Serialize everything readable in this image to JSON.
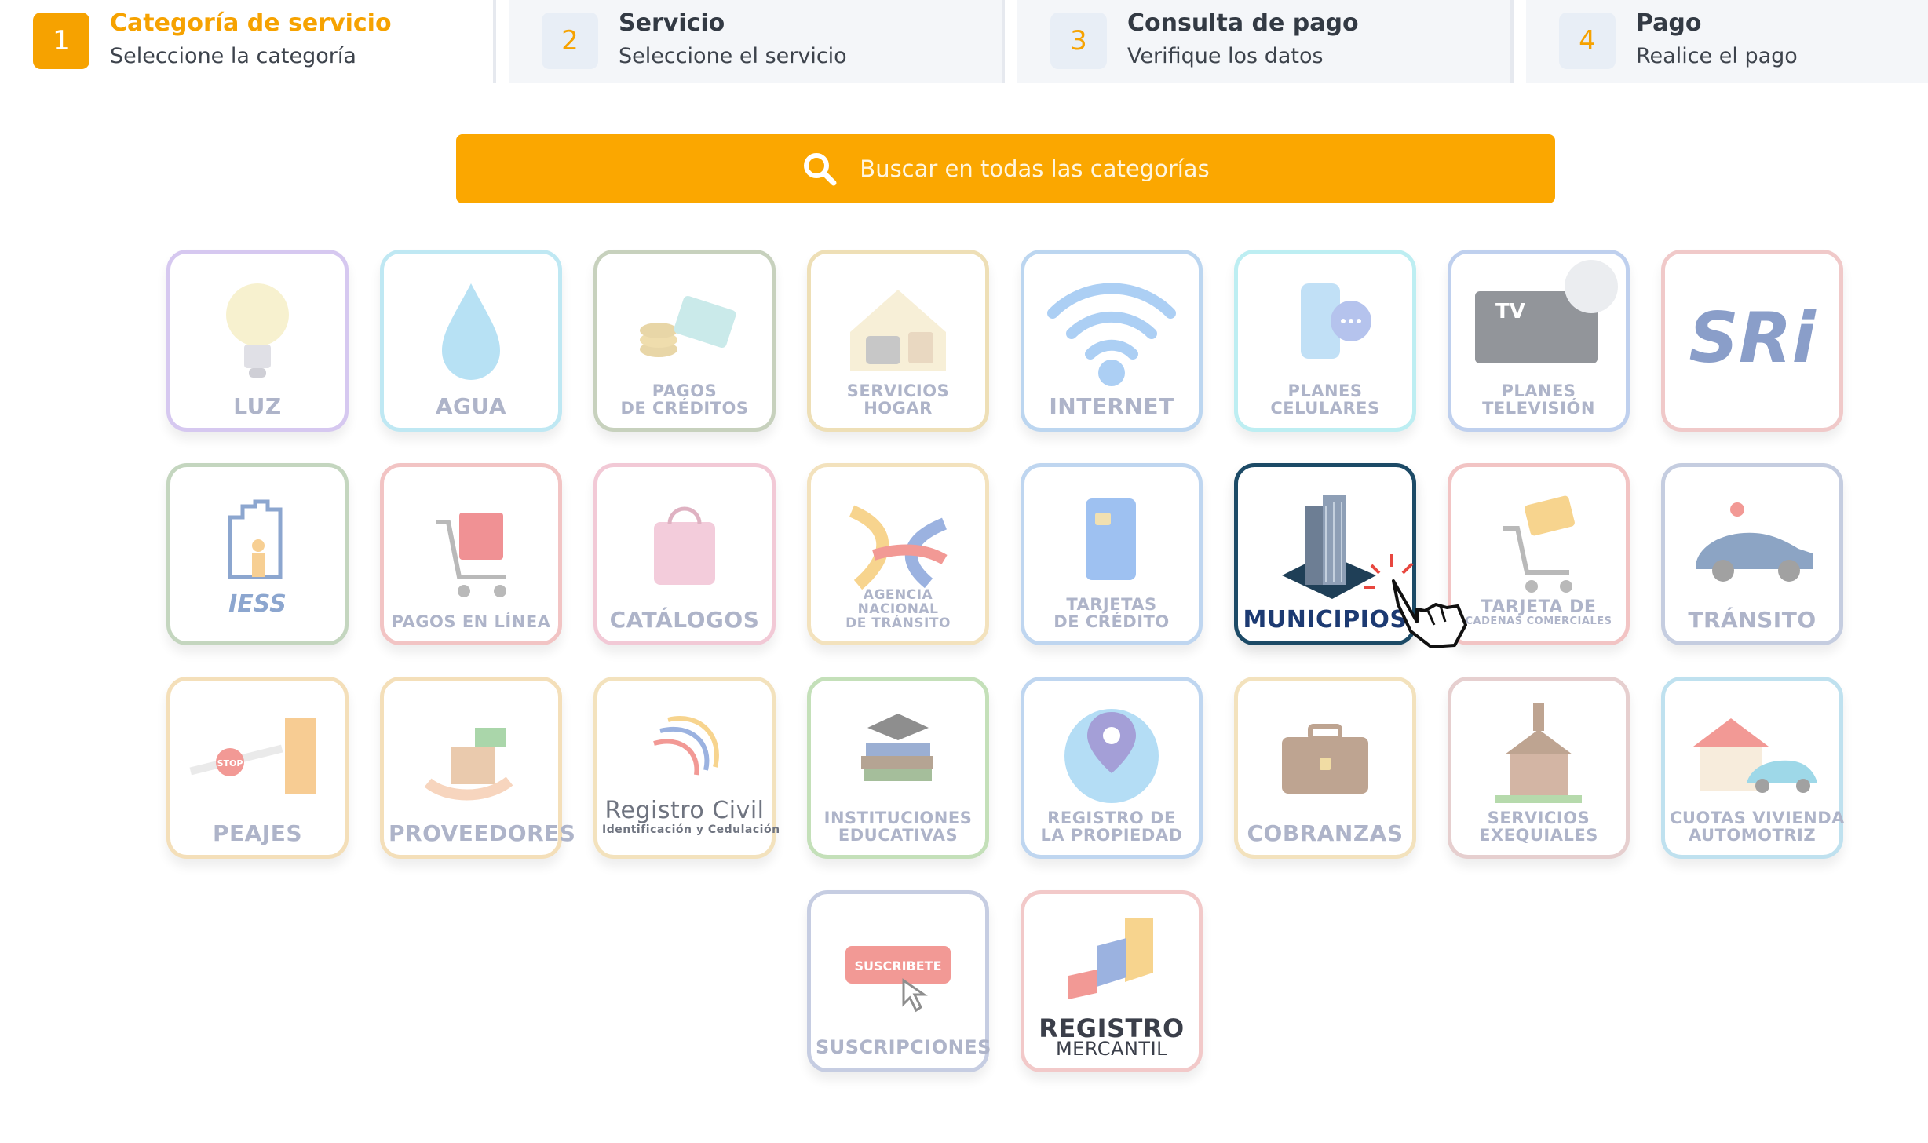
{
  "steps": [
    {
      "num": "1",
      "title": "Categoría de servicio",
      "subtitle": "Seleccione la categoría"
    },
    {
      "num": "2",
      "title": "Servicio",
      "subtitle": "Seleccione el servicio"
    },
    {
      "num": "3",
      "title": "Consulta de pago",
      "subtitle": "Verifique los datos"
    },
    {
      "num": "4",
      "title": "Pago",
      "subtitle": "Realice el pago"
    }
  ],
  "search": {
    "label": "Buscar en todas las categorías"
  },
  "categories": {
    "luz": "LUZ",
    "agua": "AGUA",
    "pagos_creditos": [
      "PAGOS",
      "DE CRÉDITOS"
    ],
    "servicios_hogar": [
      "SERVICIOS",
      "HOGAR"
    ],
    "internet": "INTERNET",
    "planes_celulares": [
      "PLANES",
      "CELULARES"
    ],
    "planes_television": [
      "PLANES",
      "TELEVISIÓN"
    ],
    "planes_television_tv": "TV",
    "sri": "SRi",
    "iess": "IESS",
    "pagos_linea": "PAGOS EN LÍNEA",
    "catalogos": "CATÁLOGOS",
    "ant": [
      "AGENCIA",
      "NACIONAL",
      "DE TRÁNSITO"
    ],
    "tarjetas_credito": [
      "TARJETAS",
      "DE CRÉDITO"
    ],
    "municipios": "MUNICIPIOS",
    "tarjeta_cadenas": [
      "TARJETA DE",
      "CADENAS COMERCIALES"
    ],
    "transito": "TRÁNSITO",
    "peajes": "PEAJES",
    "peajes_stop": "STOP",
    "proveedores": "PROVEEDORES",
    "registro_civil": [
      "Registro Civil",
      "Identificación y Cedulación"
    ],
    "instituciones": [
      "INSTITUCIONES",
      "EDUCATIVAS"
    ],
    "registro_propiedad": [
      "REGISTRO DE",
      "LA PROPIEDAD"
    ],
    "cobranzas": "COBRANZAS",
    "exequiales": [
      "SERVICIOS",
      "EXEQUIALES"
    ],
    "vivienda": [
      "CUOTAS VIVIENDA",
      "AUTOMOTRIZ"
    ],
    "suscripciones": "SUSCRIPCIONES",
    "suscribete": "SUSCRIBETE",
    "registro_mercantil": [
      "REGISTRO",
      "MERCANTIL"
    ]
  },
  "colors": {
    "accent": "#f6a200",
    "search": "#fba700",
    "active_border": "#1c4a66",
    "active_label": "#1c3a72",
    "label": "#aeb4c9"
  }
}
